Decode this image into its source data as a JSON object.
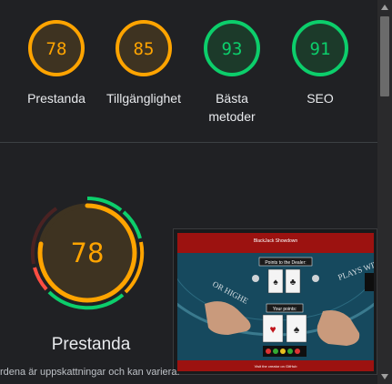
{
  "colors": {
    "average": "#ffa400",
    "pass": "#0cce6b",
    "fail": "#ff4e42",
    "average_bg": "#3e3321",
    "pass_bg": "#1c3a2a"
  },
  "scores": [
    {
      "value": "78",
      "label": "Prestanda",
      "rating": "average"
    },
    {
      "value": "85",
      "label": "Tillgänglighet",
      "rating": "average"
    },
    {
      "value": "93",
      "label": "Bästa metoder",
      "rating": "pass"
    },
    {
      "value": "91",
      "label": "SEO",
      "rating": "pass"
    }
  ],
  "performance": {
    "value": "78",
    "label": "Prestanda",
    "fraction": 0.78
  },
  "thumbnail": {
    "site_title": "BlackJack Showdown",
    "dealer_label": "Points to the Dealer:",
    "player_label": "Your points:",
    "felt_text": "PLAYS WITH",
    "felt_text_left": "OR HIGHE",
    "footer_text": "Visit the creator on GitHub"
  },
  "footnote": "rdena är uppskattningar och kan variera."
}
